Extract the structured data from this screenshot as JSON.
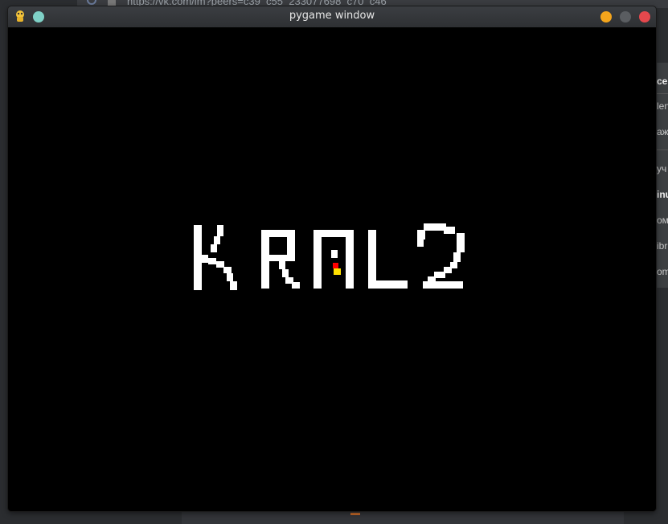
{
  "background": {
    "url_text": "https://vk.com/im?peers=c39_c55_233077698_c70_c46",
    "side_rows": [
      "ce",
      "len",
      "аж",
      "уч",
      "inu",
      "ом",
      "ibr",
      "om"
    ]
  },
  "window": {
    "title": "pygame window",
    "icons": {
      "app": "pygame-snake-icon",
      "pin": "pin-icon",
      "minimize": "minimize-icon",
      "maximize": "maximize-icon",
      "close": "close-icon"
    },
    "colors": {
      "minimize": "#f4a51c",
      "maximize": "#5a5d61",
      "close": "#e5484d",
      "pin": "#7fd1c7"
    }
  },
  "game": {
    "text": "KRAL2",
    "text_color": "#ffffff",
    "background_color": "#000000",
    "cursor_colors": [
      "#ff0000",
      "#ffe000"
    ]
  }
}
